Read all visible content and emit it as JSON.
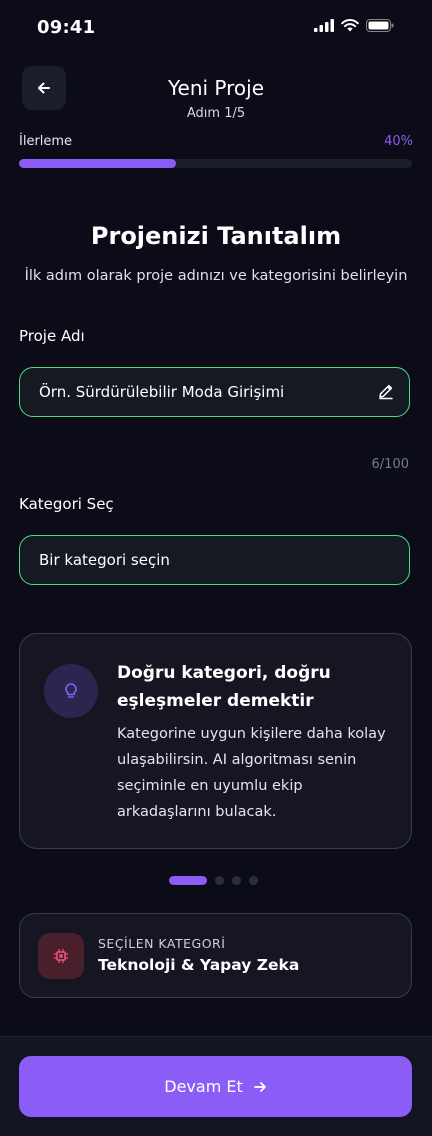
{
  "status_bar": {
    "time": "09:41"
  },
  "header": {
    "title": "Yeni Proje",
    "step": "Adım 1/5"
  },
  "progress": {
    "label": "İlerleme",
    "percent_text": "40%",
    "value": 0.4
  },
  "intro": {
    "heading": "Projenizi Tanıtalım",
    "subtitle": "İlk adım olarak proje adınızı ve kategorisini belirleyin"
  },
  "project_name": {
    "label": "Proje Adı",
    "placeholder": "Örn. Sürdürülebilir Moda Girişimi",
    "counter": "6/100"
  },
  "category": {
    "label": "Kategori Seç",
    "placeholder": "Bir kategori seçin"
  },
  "info_card": {
    "title": "Doğru kategori, doğru eşleşmeler demektir",
    "body": "Kategorine uygun kişilere daha kolay ulaşabilirsin. AI algoritması senin seçiminle en uyumlu ekip arkadaşlarını bulacak.",
    "pager_total": 4,
    "pager_active": 1
  },
  "selected_category": {
    "caption": "SEÇİLEN KATEGORİ",
    "value": "Teknoloji & Yapay Zeka"
  },
  "footer": {
    "button_label": "Devam Et"
  },
  "colors": {
    "accent": "#8b5cf6",
    "success_border": "#4ade80",
    "background": "#0b0c18"
  }
}
